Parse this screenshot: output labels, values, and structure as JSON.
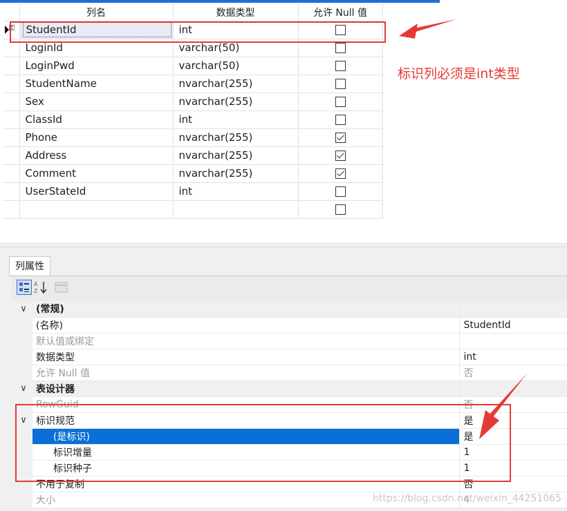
{
  "grid": {
    "headers": [
      "列名",
      "数据类型",
      "允许 Null 值"
    ],
    "rows": [
      {
        "name": "StudentId",
        "type": "int",
        "null": false
      },
      {
        "name": "LoginId",
        "type": "varchar(50)",
        "null": false
      },
      {
        "name": "LoginPwd",
        "type": "varchar(50)",
        "null": false
      },
      {
        "name": "StudentName",
        "type": "nvarchar(255)",
        "null": false
      },
      {
        "name": "Sex",
        "type": "nvarchar(255)",
        "null": false
      },
      {
        "name": "ClassId",
        "type": "int",
        "null": false
      },
      {
        "name": "Phone",
        "type": "nvarchar(255)",
        "null": true
      },
      {
        "name": "Address",
        "type": "nvarchar(255)",
        "null": true
      },
      {
        "name": "Comment",
        "type": "nvarchar(255)",
        "null": true
      },
      {
        "name": "UserStateId",
        "type": "int",
        "null": false
      },
      {
        "name": "",
        "type": "",
        "null": false
      }
    ]
  },
  "annotation": {
    "note": "标识列必须是int类型",
    "color": "#e53935"
  },
  "props_pane": {
    "tab": "列属性",
    "rows": [
      {
        "kind": "cat",
        "toggle": "∨",
        "label": "(常规)",
        "value": ""
      },
      {
        "kind": "item",
        "label": "(名称)",
        "value": "StudentId"
      },
      {
        "kind": "dim",
        "label": "默认值或绑定",
        "value": ""
      },
      {
        "kind": "item",
        "label": "数据类型",
        "value": "int"
      },
      {
        "kind": "dim",
        "label": "允许 Null 值",
        "value": "否"
      },
      {
        "kind": "cat",
        "toggle": "∨",
        "label": "表设计器",
        "value": ""
      },
      {
        "kind": "dim",
        "label": "RowGuid",
        "value": "否"
      },
      {
        "kind": "item",
        "toggle": "∨",
        "label": "标识规范",
        "value": "是"
      },
      {
        "kind": "sub-hl",
        "label": "(是标识)",
        "value": "是"
      },
      {
        "kind": "sub",
        "label": "标识增量",
        "value": "1"
      },
      {
        "kind": "sub",
        "label": "标识种子",
        "value": "1"
      },
      {
        "kind": "item",
        "label": "不用于复制",
        "value": "否"
      },
      {
        "kind": "dim",
        "label": "大小",
        "value": "4"
      }
    ]
  },
  "watermark": "https://blog.csdn.net/weixin_44251065",
  "colors": {
    "accent": "#0a6fd6",
    "highlight_border": "#e53935"
  }
}
